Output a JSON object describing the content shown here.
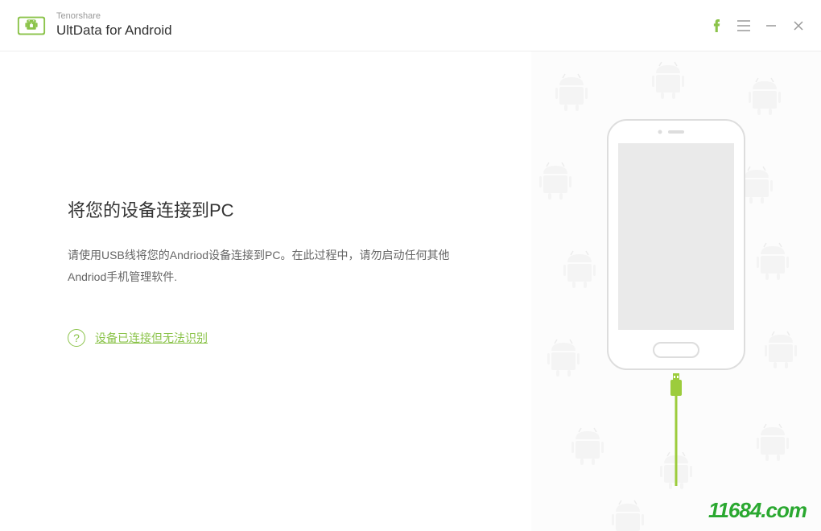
{
  "header": {
    "company": "Tenorshare",
    "product": "UltData for Android"
  },
  "content": {
    "heading": "将您的设备连接到PC",
    "description": "请使用USB线将您的Andriod设备连接到PC。在此过程中，请勿启动任何其他Andriod手机管理软件.",
    "help_link": "设备已连接但无法识别"
  },
  "watermark": "11684.com"
}
